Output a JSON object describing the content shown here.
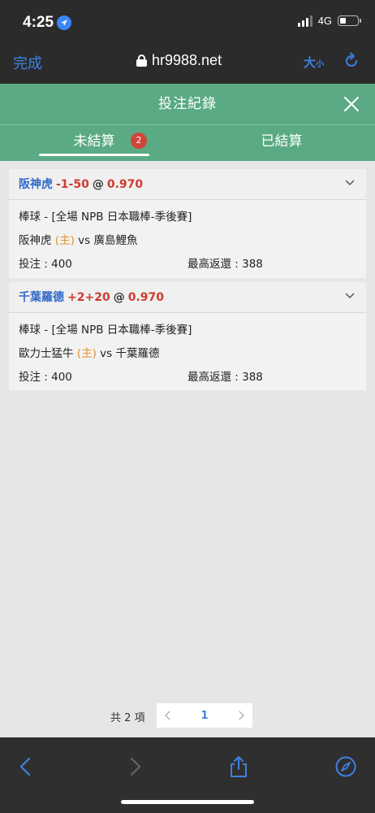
{
  "status_bar": {
    "time": "4:25",
    "network": "4G"
  },
  "browser": {
    "done_label": "完成",
    "url": "hr9988.net",
    "text_size_big": "大",
    "text_size_small": "小"
  },
  "modal": {
    "title": "投注紀錄",
    "tabs": [
      {
        "label": "未結算",
        "badge": "2",
        "active": true
      },
      {
        "label": "已結算",
        "active": false
      }
    ]
  },
  "bets": [
    {
      "team": "阪神虎",
      "handicap": "-1-50",
      "at": "@",
      "odds": "0.970",
      "sport_line": "棒球 - [全場 NPB 日本職棒-季後賽]",
      "home_team": "阪神虎",
      "home_tag": "(主)",
      "vs": "vs",
      "away_team": "廣島鯉魚",
      "stake": "投注 : 400",
      "max_return": "最高返還 : 388"
    },
    {
      "team": "千葉羅德",
      "handicap": "+2+20",
      "at": "@",
      "odds": "0.970",
      "sport_line": "棒球 - [全場 NPB 日本職棒-季後賽]",
      "home_team": "歐力士猛牛",
      "home_tag": "(主)",
      "vs": "vs",
      "away_team": "千葉羅德",
      "stake": "投注 : 400",
      "max_return": "最高返還 : 388"
    }
  ],
  "pagination": {
    "total": "共 2 項",
    "current": "1"
  },
  "colors": {
    "header_green": "#5aaa83",
    "link_blue": "#2f69c8",
    "odds_red": "#d03b2e",
    "home_orange": "#e0922c",
    "badge_red": "#d0453a"
  }
}
